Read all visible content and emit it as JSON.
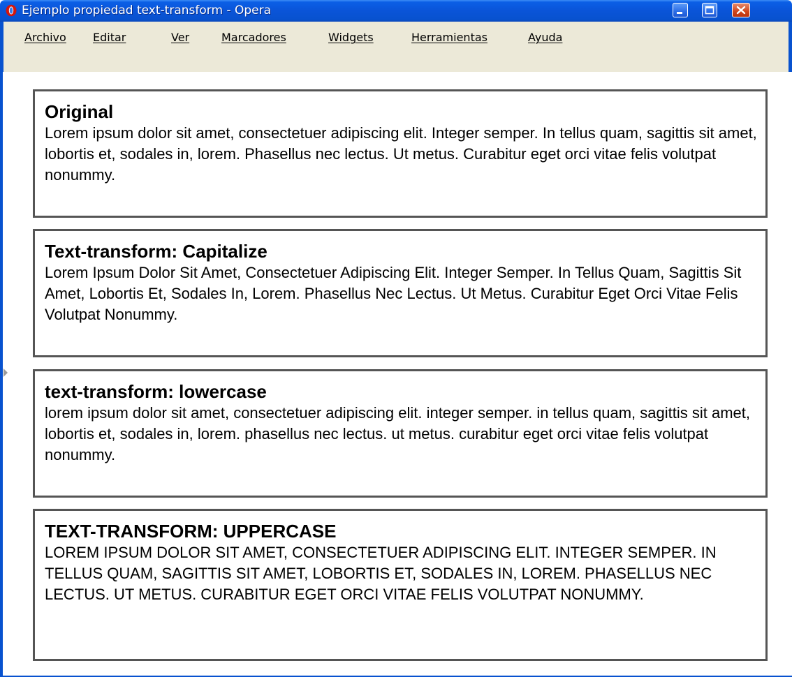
{
  "window": {
    "title": "Ejemplo propiedad text-transform - Opera",
    "icon": "opera-icon",
    "controls": [
      "minimize-icon",
      "maximize-icon",
      "close-icon"
    ]
  },
  "menubar": {
    "items": [
      "Archivo",
      "Editar",
      "Ver",
      "Marcadores",
      "Widgets",
      "Herramientas",
      "Ayuda"
    ]
  },
  "sections": [
    {
      "heading": "Original",
      "text": "Lorem ipsum dolor sit amet, consectetuer adipiscing elit. Integer semper. In tellus quam, sagittis sit amet, lobortis et, sodales in, lorem. Phasellus nec lectus. Ut metus. Curabitur eget orci vitae felis volutpat nonummy."
    },
    {
      "heading": "Text-transform: Capitalize",
      "text": "Lorem Ipsum Dolor Sit Amet, Consectetuer Adipiscing Elit. Integer Semper. In Tellus Quam, Sagittis Sit Amet, Lobortis Et, Sodales In, Lorem. Phasellus Nec Lectus. Ut Metus. Curabitur Eget Orci Vitae Felis Volutpat Nonummy."
    },
    {
      "heading": "text-transform: lowercase",
      "text": "lorem ipsum dolor sit amet, consectetuer adipiscing elit. integer semper. in tellus quam, sagittis sit amet, lobortis et, sodales in, lorem. phasellus nec lectus. ut metus. curabitur eget orci vitae felis volutpat nonummy."
    },
    {
      "heading": "TEXT-TRANSFORM: UPPERCASE",
      "text": "LOREM IPSUM DOLOR SIT AMET, CONSECTETUER ADIPISCING ELIT. INTEGER SEMPER. IN TELLUS QUAM, SAGITTIS SIT AMET, LOBORTIS ET, SODALES IN, LOREM. PHASELLUS NEC LECTUS. UT METUS. CURABITUR EGET ORCI VITAE FELIS VOLUTPAT NONUMMY."
    }
  ],
  "colors": {
    "titlebar": "#0852cf",
    "menubar": "#ece9d8",
    "box_border": "#555555"
  }
}
